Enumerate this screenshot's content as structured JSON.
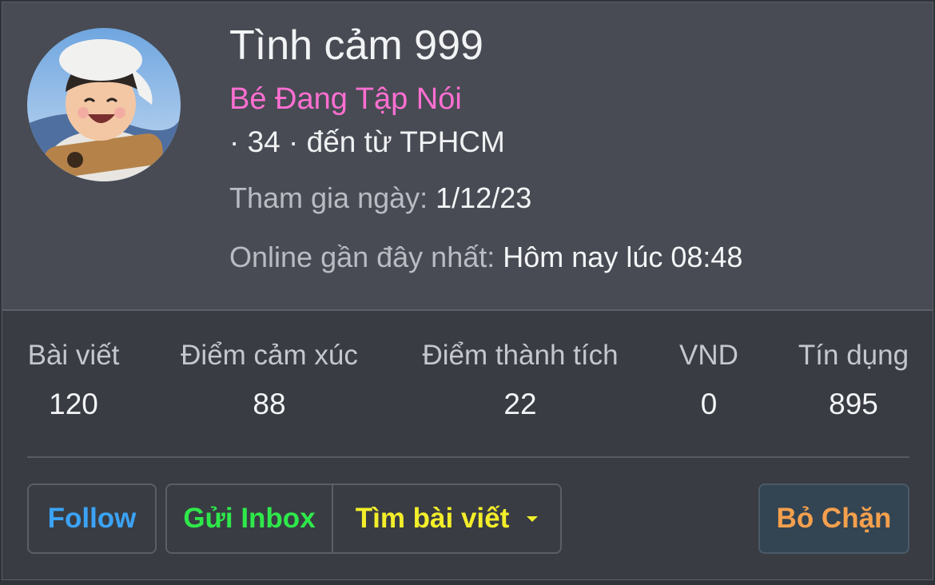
{
  "profile": {
    "name": "Tình cảm 999",
    "title": "Bé Đang Tập Nói",
    "info": "· 34 · đến từ TPHCM",
    "joined_label": "Tham gia ngày:",
    "joined_value": "1/12/23",
    "online_label": "Online gần đây nhất:",
    "online_value": "Hôm nay lúc 08:48"
  },
  "stats": [
    {
      "label": "Bài viết",
      "value": "120"
    },
    {
      "label": "Điểm cảm xúc",
      "value": "88"
    },
    {
      "label": "Điểm thành tích",
      "value": "22"
    },
    {
      "label": "VND",
      "value": "0"
    },
    {
      "label": "Tín dụng",
      "value": "895"
    }
  ],
  "actions": {
    "follow": "Follow",
    "inbox": "Gửi Inbox",
    "search_posts": "Tìm bài viết",
    "unblock": "Bỏ Chặn"
  },
  "colors": {
    "title": "#ff6fd2",
    "follow": "#3ba3f5",
    "inbox": "#2ee84a",
    "search_posts": "#f3ee2a",
    "unblock": "#f5a04d"
  }
}
